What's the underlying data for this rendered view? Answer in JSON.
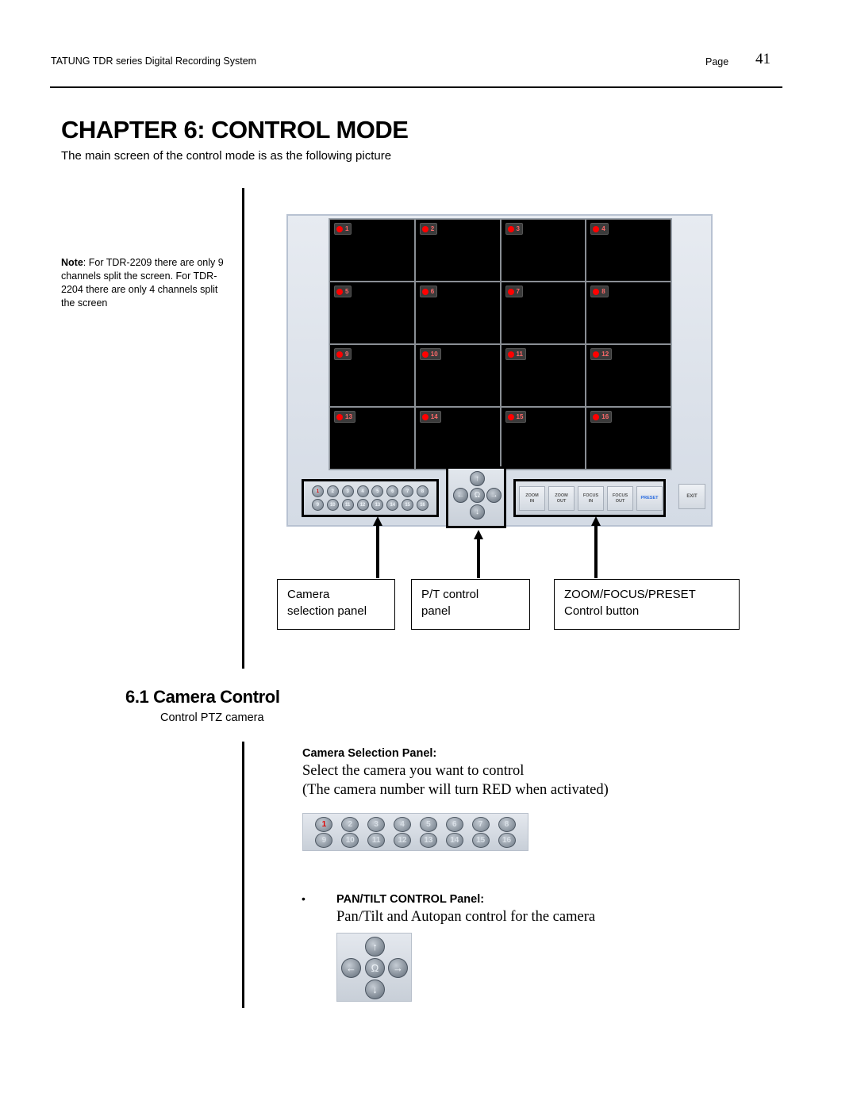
{
  "header": {
    "doc_title": "TATUNG TDR series Digital Recording System",
    "page_label": "Page",
    "page_number": "41"
  },
  "chapter": {
    "title": "CHAPTER 6: CONTROL MODE",
    "intro": "The main screen of the control mode is as the following picture"
  },
  "note": {
    "label": "Note",
    "text": ": For TDR-2209 there are only 9 channels split the screen. For TDR-2204 there are only 4 channels split the screen"
  },
  "dvr_screen": {
    "channels": [
      "1",
      "2",
      "3",
      "4",
      "5",
      "6",
      "7",
      "8",
      "9",
      "10",
      "11",
      "12",
      "13",
      "14",
      "15",
      "16"
    ],
    "record_indicator_color": "#ff0000",
    "camera_buttons": [
      "1",
      "2",
      "3",
      "4",
      "5",
      "6",
      "7",
      "8",
      "9",
      "10",
      "11",
      "12",
      "13",
      "14",
      "15",
      "16"
    ],
    "active_camera": "1",
    "active_color": "#e00000",
    "pt_buttons": {
      "up": "↑",
      "left": "←",
      "center": "Ω",
      "right": "→",
      "down": "↓"
    },
    "zf_buttons": [
      "ZOOM\nIN",
      "ZOOM\nOUT",
      "FOCUS\nIN",
      "FOCUS\nOUT",
      "PRESET"
    ],
    "preset_color": "#2f6fe0",
    "exit_label": "EXIT"
  },
  "callouts": {
    "camera": "Camera\nselection panel",
    "pt": "P/T control\npanel",
    "zf": "ZOOM/FOCUS/PRESET\nControl button"
  },
  "section": {
    "title": "6.1 Camera Control",
    "subtitle": "Control PTZ camera",
    "camera_selection": {
      "title": "Camera Selection Panel:",
      "line1": "Select the camera you want to control",
      "line2": "(The camera number will turn RED when activated)"
    },
    "pan_tilt": {
      "bullet": "•",
      "title": "PAN/TILT CONTROL Panel:",
      "line1": "Pan/Tilt and Autopan control for the camera"
    }
  }
}
